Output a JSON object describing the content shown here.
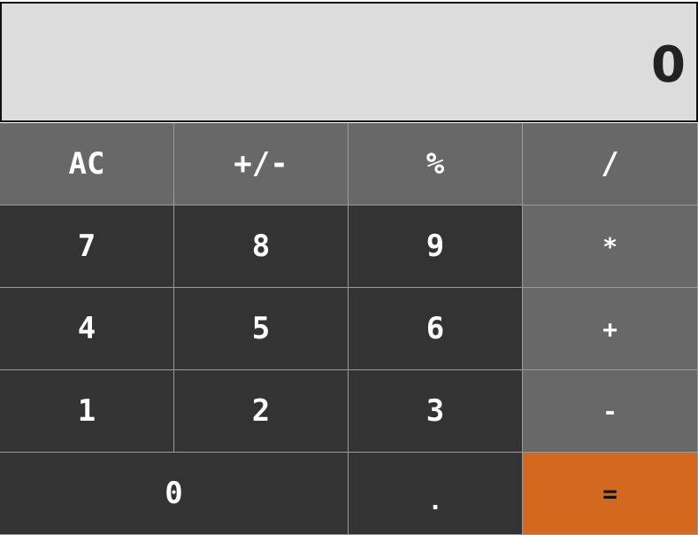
{
  "display": {
    "value": "0"
  },
  "keys": {
    "ac": "AC",
    "sign": "+/-",
    "percent": "%",
    "divide": "/",
    "seven": "7",
    "eight": "8",
    "nine": "9",
    "multiply": "*",
    "four": "4",
    "five": "5",
    "six": "6",
    "plus": "+",
    "one": "1",
    "two": "2",
    "three": "3",
    "minus": "-",
    "zero": "0",
    "dot": ".",
    "equals": "="
  },
  "colors": {
    "display_bg": "#dcdcdc",
    "function_key": "#686868",
    "number_key": "#333333",
    "operator_key": "#686868",
    "equals_key": "#d2691e"
  }
}
